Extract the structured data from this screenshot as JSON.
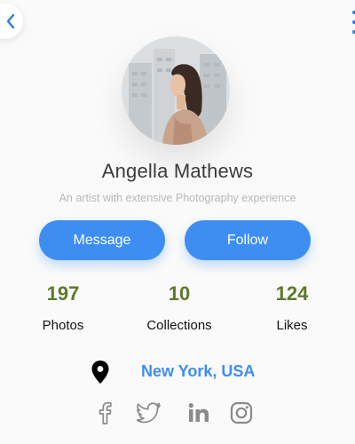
{
  "profile": {
    "name": "Angella Mathews",
    "bio": "An artist with extensive Photography experience"
  },
  "actions": {
    "message_label": "Message",
    "follow_label": "Follow"
  },
  "stats": [
    {
      "value": "197",
      "label": "Photos"
    },
    {
      "value": "10",
      "label": "Collections"
    },
    {
      "value": "124",
      "label": "Likes"
    }
  ],
  "location": {
    "icon": "map-pin-icon",
    "text": "New York, USA"
  },
  "social": {
    "icons": [
      "facebook-icon",
      "twitter-icon",
      "linkedin-icon",
      "instagram-icon"
    ]
  },
  "nav": {
    "back_icon": "chevron-left-icon",
    "menu_icon": "more-vertical-icon"
  },
  "colors": {
    "accent": "#3e8ef2",
    "stat_value": "#5c7a2a",
    "social_icon": "#8a8a8a",
    "background": "#fafafa"
  }
}
